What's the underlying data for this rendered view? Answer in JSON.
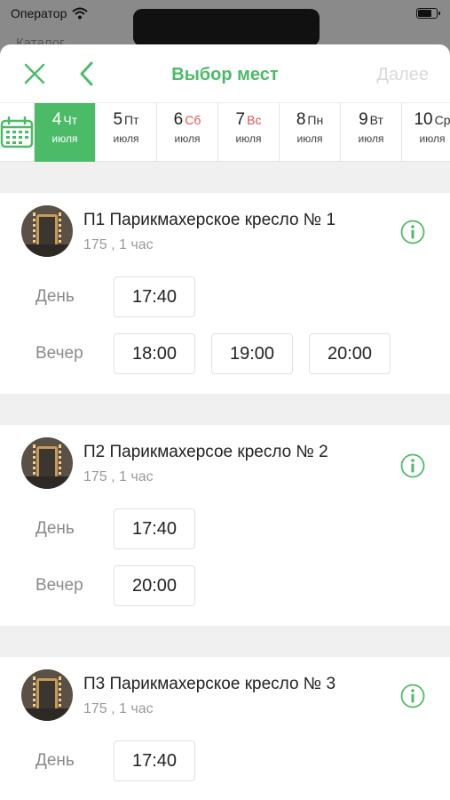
{
  "status_bar": {
    "carrier": "Оператор"
  },
  "background": {
    "back_label": "Каталог"
  },
  "nav": {
    "title": "Выбор мест",
    "next_label": "Далее"
  },
  "dates": [
    {
      "day": "4",
      "dow": "Чт",
      "month": "июля",
      "selected": true,
      "weekend": false
    },
    {
      "day": "5",
      "dow": "Пт",
      "month": "июля",
      "selected": false,
      "weekend": false
    },
    {
      "day": "6",
      "dow": "Сб",
      "month": "июля",
      "selected": false,
      "weekend": true
    },
    {
      "day": "7",
      "dow": "Вс",
      "month": "июля",
      "selected": false,
      "weekend": true
    },
    {
      "day": "8",
      "dow": "Пн",
      "month": "июля",
      "selected": false,
      "weekend": false
    },
    {
      "day": "9",
      "dow": "Вт",
      "month": "июля",
      "selected": false,
      "weekend": false
    },
    {
      "day": "10",
      "dow": "Ср",
      "month": "июля",
      "selected": false,
      "weekend": false
    }
  ],
  "colors": {
    "accent": "#4cbb68",
    "weekend": "#e05050",
    "disabled": "#d9d9d9"
  },
  "resources": [
    {
      "title": "П1 Парикмахерское кресло № 1",
      "subtitle": "175 , 1 час",
      "rows": [
        {
          "label": "День",
          "times": [
            "17:40"
          ]
        },
        {
          "label": "Вечер",
          "times": [
            "18:00",
            "19:00",
            "20:00"
          ]
        }
      ]
    },
    {
      "title": "П2 Парикмахерсое кресло № 2",
      "subtitle": "175 , 1 час",
      "rows": [
        {
          "label": "День",
          "times": [
            "17:40"
          ]
        },
        {
          "label": "Вечер",
          "times": [
            "20:00"
          ]
        }
      ]
    },
    {
      "title": "П3 Парикмахерское кресло № 3",
      "subtitle": "175 , 1 час",
      "rows": [
        {
          "label": "День",
          "times": [
            "17:40"
          ]
        }
      ]
    }
  ]
}
